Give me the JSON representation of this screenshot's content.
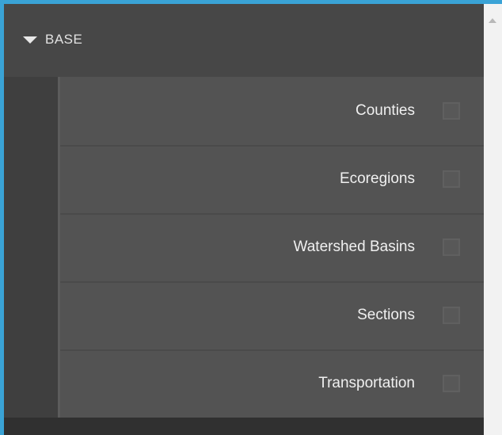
{
  "base_group": {
    "label": "BASE",
    "expanded": true,
    "toggle_icon": "caret-down-icon"
  },
  "layers": [
    {
      "label": "Counties",
      "checked": false
    },
    {
      "label": "Ecoregions",
      "checked": false
    },
    {
      "label": "Watershed Basins",
      "checked": false
    },
    {
      "label": "Sections",
      "checked": false
    },
    {
      "label": "Transportation",
      "checked": false
    }
  ],
  "colors": {
    "frame": "#3aa3d6",
    "panel": "#3f3f3f",
    "header": "#474747",
    "list": "#535353",
    "text": "#f0f0f0"
  }
}
